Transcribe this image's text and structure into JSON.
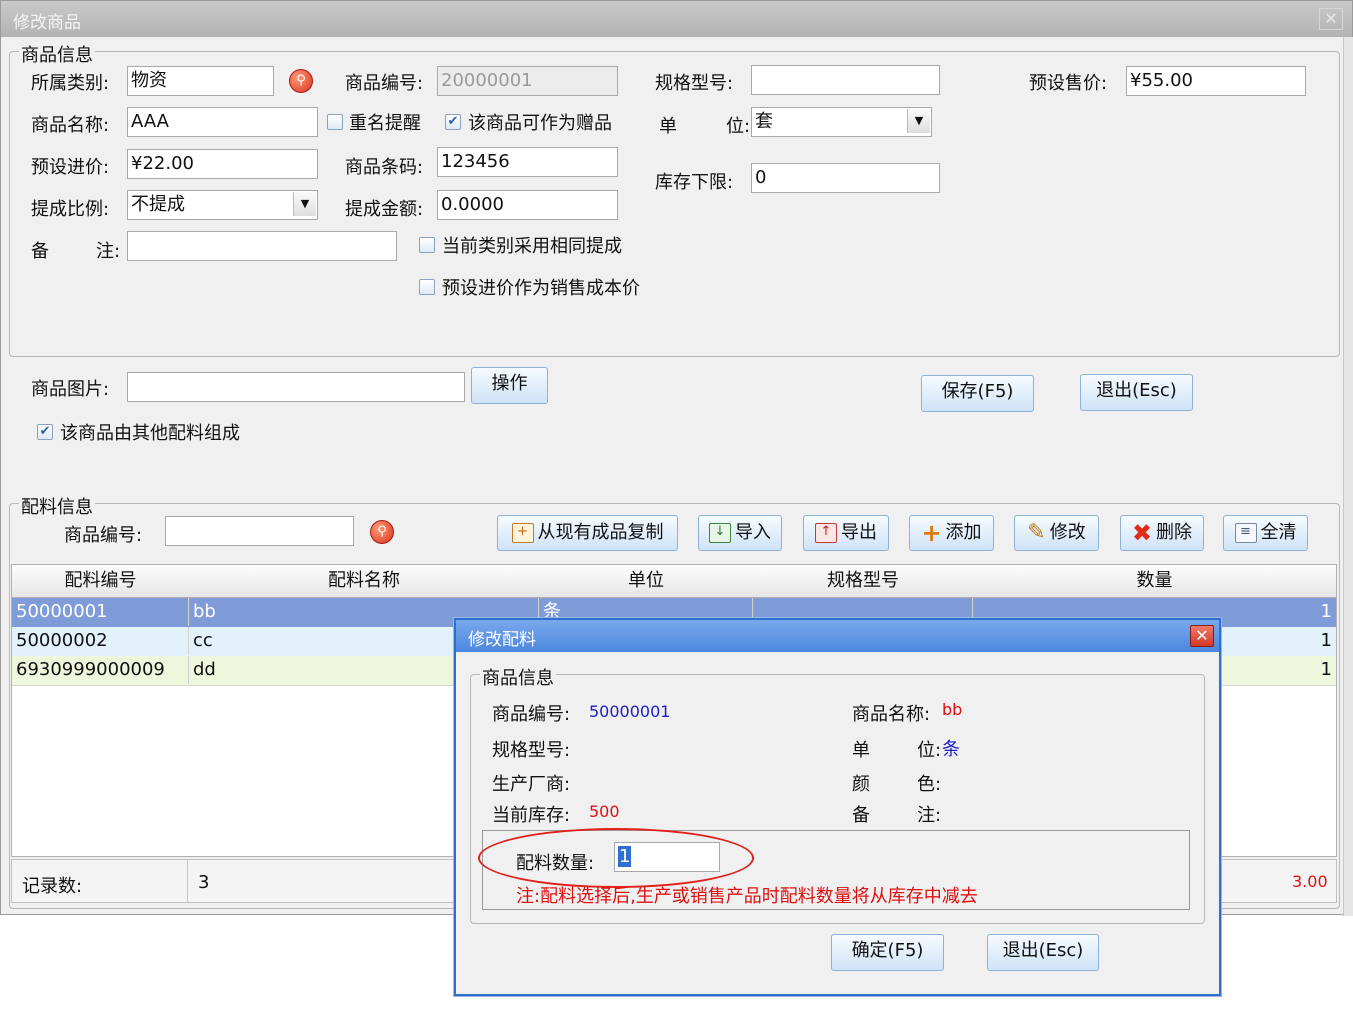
{
  "window": {
    "title": "修改商品",
    "close_glyph": "✕"
  },
  "product_info": {
    "group_title": "商品信息",
    "category_label": "所属类别:",
    "category_value": "物资",
    "code_label": "商品编号:",
    "code_value": "20000001",
    "spec_label": "规格型号:",
    "spec_value": "",
    "sale_price_label": "预设售价:",
    "sale_price_value": "¥55.00",
    "name_label": "商品名称:",
    "name_value": "AAA",
    "dup_name_label": "重名提醒",
    "dup_name_checked": false,
    "gift_label": "该商品可作为赠品",
    "gift_checked": true,
    "unit_label_a": "单",
    "unit_label_b": "位:",
    "unit_value": "套",
    "purchase_price_label": "预设进价:",
    "purchase_price_value": "¥22.00",
    "barcode_label": "商品条码:",
    "barcode_value": "123456",
    "stock_min_label": "库存下限:",
    "stock_min_value": "0",
    "commission_ratio_label": "提成比例:",
    "commission_ratio_value": "不提成",
    "commission_amount_label": "提成金额:",
    "commission_amount_value": "0.0000",
    "remark_label_a": "备",
    "remark_label_b": "注:",
    "remark_value": "",
    "same_commission_label": "当前类别采用相同提成",
    "same_commission_checked": false,
    "cost_price_label": "预设进价作为销售成本价",
    "cost_price_checked": false
  },
  "image_row": {
    "label": "商品图片:",
    "value": "",
    "operate_button": "操作"
  },
  "actions": {
    "save": "保存(F5)",
    "exit": "退出(Esc)"
  },
  "composed": {
    "label": "该商品由其他配料组成",
    "checked": true
  },
  "ingredient_info": {
    "group_title": "配料信息",
    "code_label": "商品编号:",
    "code_value": "",
    "toolbar": [
      {
        "id": "copy",
        "label": "从现有成品复制",
        "icon": "plus-box-icon"
      },
      {
        "id": "import",
        "label": "导入",
        "icon": "import-icon"
      },
      {
        "id": "export",
        "label": "导出",
        "icon": "export-icon"
      },
      {
        "id": "add",
        "label": "添加",
        "icon": "plus-icon"
      },
      {
        "id": "edit",
        "label": "修改",
        "icon": "wrench-icon"
      },
      {
        "id": "delete",
        "label": "删除",
        "icon": "delete-x-icon"
      },
      {
        "id": "clear",
        "label": "全清",
        "icon": "clear-doc-icon"
      }
    ]
  },
  "grid": {
    "columns": [
      "配料编号",
      "配料名称",
      "单位",
      "规格型号",
      "数量"
    ],
    "rows": [
      {
        "code": "50000001",
        "name": "bb",
        "unit": "条",
        "spec": "",
        "qty": "1"
      },
      {
        "code": "50000002",
        "name": "cc",
        "unit": "",
        "spec": "",
        "qty": "1"
      },
      {
        "code": "6930999000009",
        "name": "dd",
        "unit": "",
        "spec": "",
        "qty": "1"
      }
    ],
    "footer_label": "记录数:",
    "footer_count": "3",
    "footer_total": "3.00"
  },
  "modal": {
    "title": "修改配料",
    "close_glyph": "✕",
    "group_title": "商品信息",
    "code_label": "商品编号:",
    "code_value": "50000001",
    "name_label": "商品名称:",
    "name_value": "bb",
    "spec_label": "规格型号:",
    "spec_value": "",
    "unit_label_a": "单",
    "unit_label_b": "位:",
    "unit_value": "条",
    "maker_label": "生产厂商:",
    "maker_value": "",
    "color_label_a": "颜",
    "color_label_b": "色:",
    "color_value": "",
    "stock_label": "当前库存:",
    "stock_value": "500",
    "remark_label_a": "备",
    "remark_label_b": "注:",
    "remark_value": "",
    "qty_label": "配料数量:",
    "qty_value": "1",
    "note": "注:配料选择后,生产或销售产品时配料数量将从库存中减去",
    "ok": "确定(F5)",
    "exit": "退出(Esc)"
  },
  "colors": {
    "accent_blue": "#2f6fd1",
    "selected_row": "#7f9cd8",
    "row_alt_1": "#e3f1fb",
    "row_alt_2": "#eef7dc",
    "note_red": "#dd1111",
    "value_blue": "#1c1ccc"
  }
}
